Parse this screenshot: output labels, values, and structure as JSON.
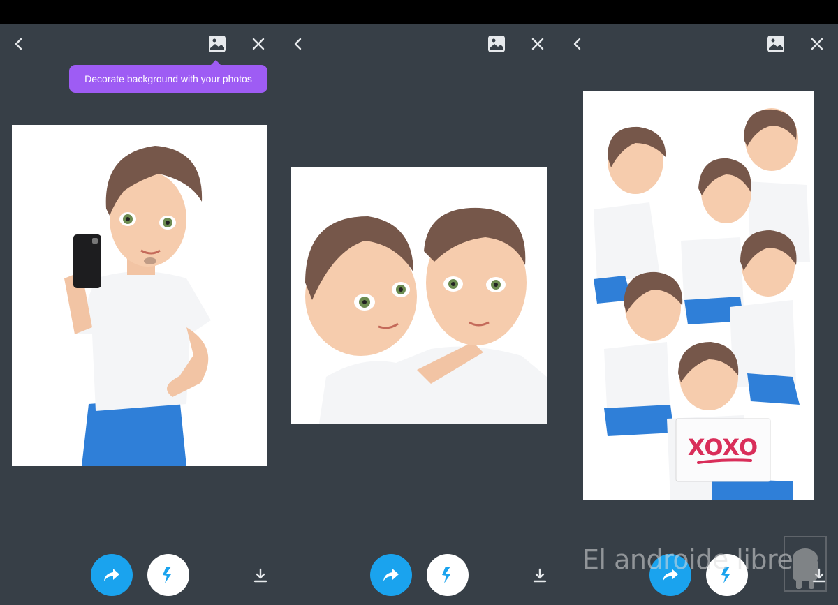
{
  "tooltip": {
    "text": "Decorate background with your photos"
  },
  "icons": {
    "back": "chevron-left-icon",
    "background": "image-icon",
    "close": "close-icon",
    "share": "share-arrow-icon",
    "flash": "lightning-icon",
    "download": "download-icon"
  },
  "sign": {
    "text": "XOXO"
  },
  "watermark": {
    "text": "El androide libre"
  },
  "colors": {
    "background": "#373f47",
    "tooltip": "#9e5cf4",
    "share_button": "#1aa3ee",
    "flash_icon": "#1aa3ee"
  }
}
